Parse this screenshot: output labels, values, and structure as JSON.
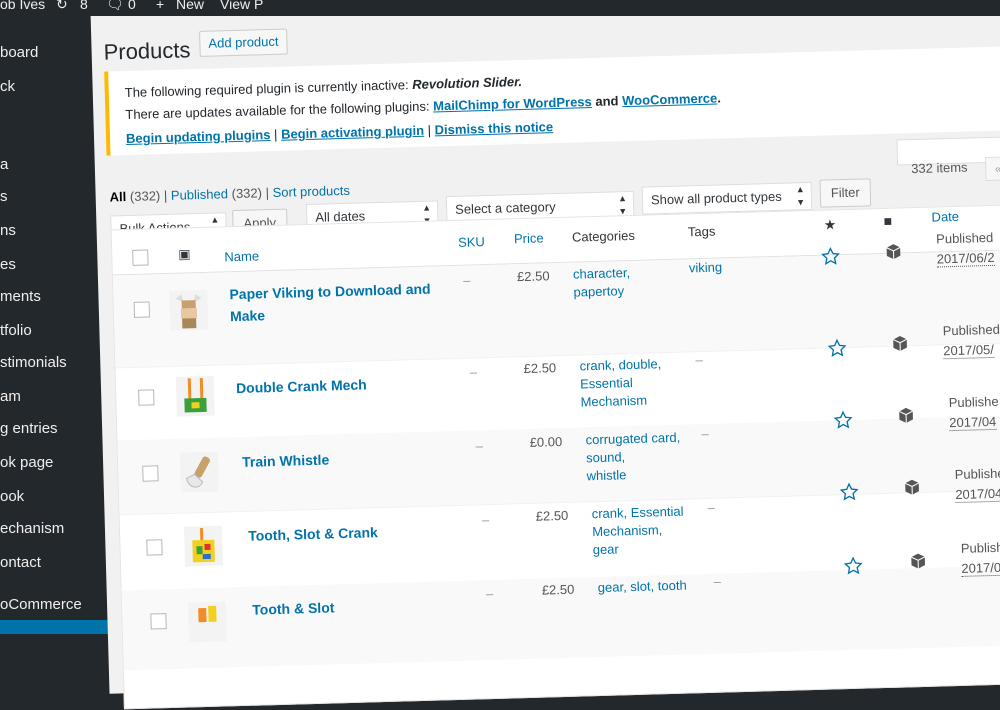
{
  "admin_bar": {
    "user_fragment": "ob Ives",
    "updates_count": "8",
    "comments_count": "0",
    "new_label": "New",
    "view_fragment": "View P"
  },
  "sidebar": {
    "items": [
      {
        "label": "board"
      },
      {
        "label": "ck"
      },
      {
        "label": "a"
      },
      {
        "label": "s"
      },
      {
        "label": "ns"
      },
      {
        "label": "es"
      },
      {
        "label": "ments"
      },
      {
        "label": "tfolio"
      },
      {
        "label": "stimonials"
      },
      {
        "label": "am"
      },
      {
        "label": "g entries"
      },
      {
        "label": "ok page"
      },
      {
        "label": "ook"
      },
      {
        "label": "echanism"
      },
      {
        "label": "ontact"
      },
      {
        "label": "oCommerce"
      }
    ]
  },
  "page": {
    "title": "Products",
    "add_button": "Add product"
  },
  "notice": {
    "line1_prefix": "The following required plugin is currently inactive:",
    "line1_plugin": "Revolution Slider.",
    "line2_prefix": "There are updates available for the following plugins:",
    "line2_plugin1": "MailChimp for WordPress",
    "line2_and": "and",
    "line2_plugin2": "WooCommerce",
    "line2_end": ".",
    "link_update": "Begin updating plugins",
    "link_activate": "Begin activating plugin",
    "link_dismiss": "Dismiss this notice",
    "sep": "|"
  },
  "views": {
    "all_label": "All",
    "all_count": "(332)",
    "published_label": "Published",
    "published_count": "(332)",
    "sort_label": "Sort products",
    "sep": "|"
  },
  "items_count": "332 items",
  "pager_first": "«",
  "filters": {
    "bulk_actions": "Bulk Actions",
    "apply": "Apply",
    "dates": "All dates",
    "category": "Select a category",
    "product_types": "Show all product types",
    "filter": "Filter"
  },
  "columns": {
    "name": "Name",
    "sku": "SKU",
    "price": "Price",
    "categories": "Categories",
    "tags": "Tags",
    "date": "Date"
  },
  "rows": [
    {
      "name": "Paper Viking to Download and Make",
      "sku": "–",
      "price": "£2.50",
      "categories": [
        "character",
        "papertoy"
      ],
      "tags": "viking",
      "status": "Published",
      "date": "2017/06/2"
    },
    {
      "name": "Double Crank Mech",
      "sku": "–",
      "price": "£2.50",
      "categories": [
        "crank",
        "double",
        "Essential Mechanism"
      ],
      "tags": "–",
      "status": "Published",
      "date": "2017/05/"
    },
    {
      "name": "Train Whistle",
      "sku": "–",
      "price": "£0.00",
      "categories": [
        "corrugated card",
        "sound",
        "whistle"
      ],
      "tags": "–",
      "status": "Publishe",
      "date": "2017/04"
    },
    {
      "name": "Tooth, Slot & Crank",
      "sku": "–",
      "price": "£2.50",
      "categories": [
        "crank",
        "Essential Mechanism",
        "gear"
      ],
      "tags": "–",
      "status": "Publishe",
      "date": "2017/04"
    },
    {
      "name": "Tooth & Slot",
      "sku": "–",
      "price": "£2.50",
      "categories": [
        "gear",
        "slot",
        "tooth"
      ],
      "tags": "–",
      "status": "Publishe",
      "date": "2017/0"
    }
  ],
  "colors": {
    "link": "#0073aa",
    "sidebar": "#23282d",
    "notice_border": "#ffb900",
    "star": "#0073aa"
  }
}
